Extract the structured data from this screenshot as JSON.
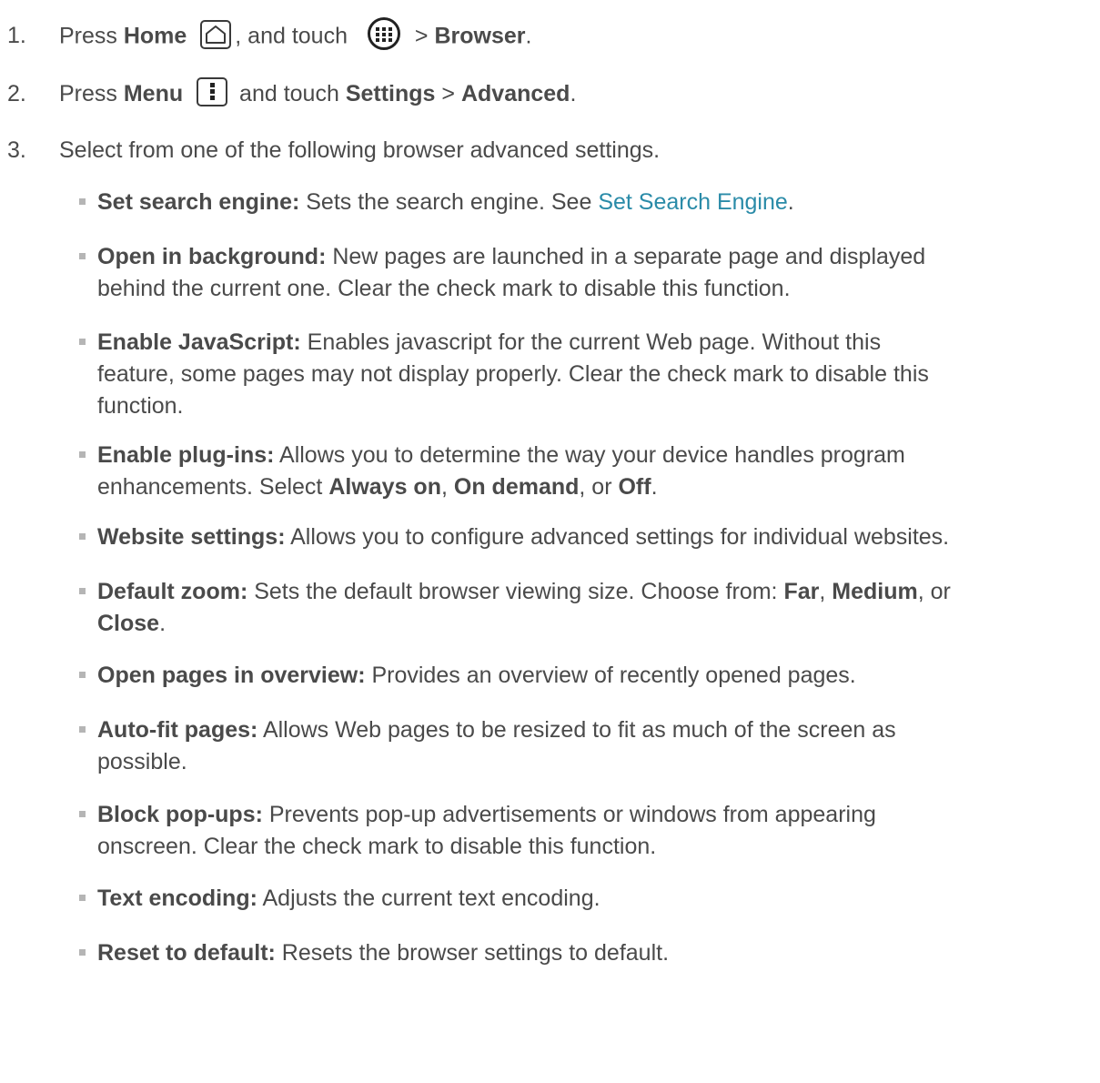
{
  "steps": [
    {
      "number": "1.",
      "press": "Press",
      "home_label": "Home",
      "and_touch": ", and touch",
      "gt": ">",
      "browser_label": "Browser",
      "period": ".",
      "icons": [
        "home-icon",
        "apps-icon"
      ]
    },
    {
      "number": "2.",
      "press": "Press",
      "menu_label": "Menu",
      "and_touch": "and touch",
      "settings_label": "Settings",
      "gt": ">",
      "advanced_label": "Advanced",
      "period": ".",
      "icons": [
        "menu-icon"
      ]
    },
    {
      "number": "3.",
      "text": "Select from one of the following browser advanced settings."
    }
  ],
  "settings": [
    {
      "term": "Set search engine:",
      "desc": " Sets the search engine. See ",
      "link": "Set Search Engine",
      "tail": "."
    },
    {
      "term": "Open in background:",
      "desc": " New pages are launched in a separate page and displayed",
      "line2": "behind the current one. Clear the check mark to disable this function."
    },
    {
      "term": "Enable JavaScript:",
      "desc": " Enables javascript for the current Web page. Without this",
      "line2": "feature, some pages may not display properly. Clear the check mark to disable this",
      "line3": "function."
    },
    {
      "term": "Enable plug-ins:",
      "desc": " Allows you to determine the way your device handles program",
      "line2a": "enhancements. Select ",
      "opt1": "Always on",
      "sep1": ", ",
      "opt2": "On demand",
      "sep2": ", or ",
      "opt3": "Off",
      "end": "."
    },
    {
      "term": "Website settings:",
      "desc": " Allows you to configure advanced settings for individual websites."
    },
    {
      "term": "Default zoom:",
      "desc": " Sets the default browser viewing size. Choose from: ",
      "opt1": "Far",
      "sep1": ", ",
      "opt2": "Medium",
      "sep2": ", or",
      "opt3": "Close",
      "end": "."
    },
    {
      "term": "Open pages in overview:",
      "desc": " Provides an overview of recently opened pages."
    },
    {
      "term": "Auto-fit pages:",
      "desc": " Allows Web pages to be resized to fit as much of the screen as",
      "line2": "possible."
    },
    {
      "term": "Block pop-ups:",
      "desc": " Prevents pop-up advertisements or windows from appearing",
      "line2": "onscreen. Clear the check mark to disable this function."
    },
    {
      "term": "Text encoding:",
      "desc": " Adjusts the current text encoding."
    },
    {
      "term": "Reset to default:",
      "desc": " Resets the browser settings to default."
    }
  ],
  "colors": {
    "text": "#4a4a4a",
    "link": "#2a8ba8",
    "bullet": "#b5b5b5"
  }
}
